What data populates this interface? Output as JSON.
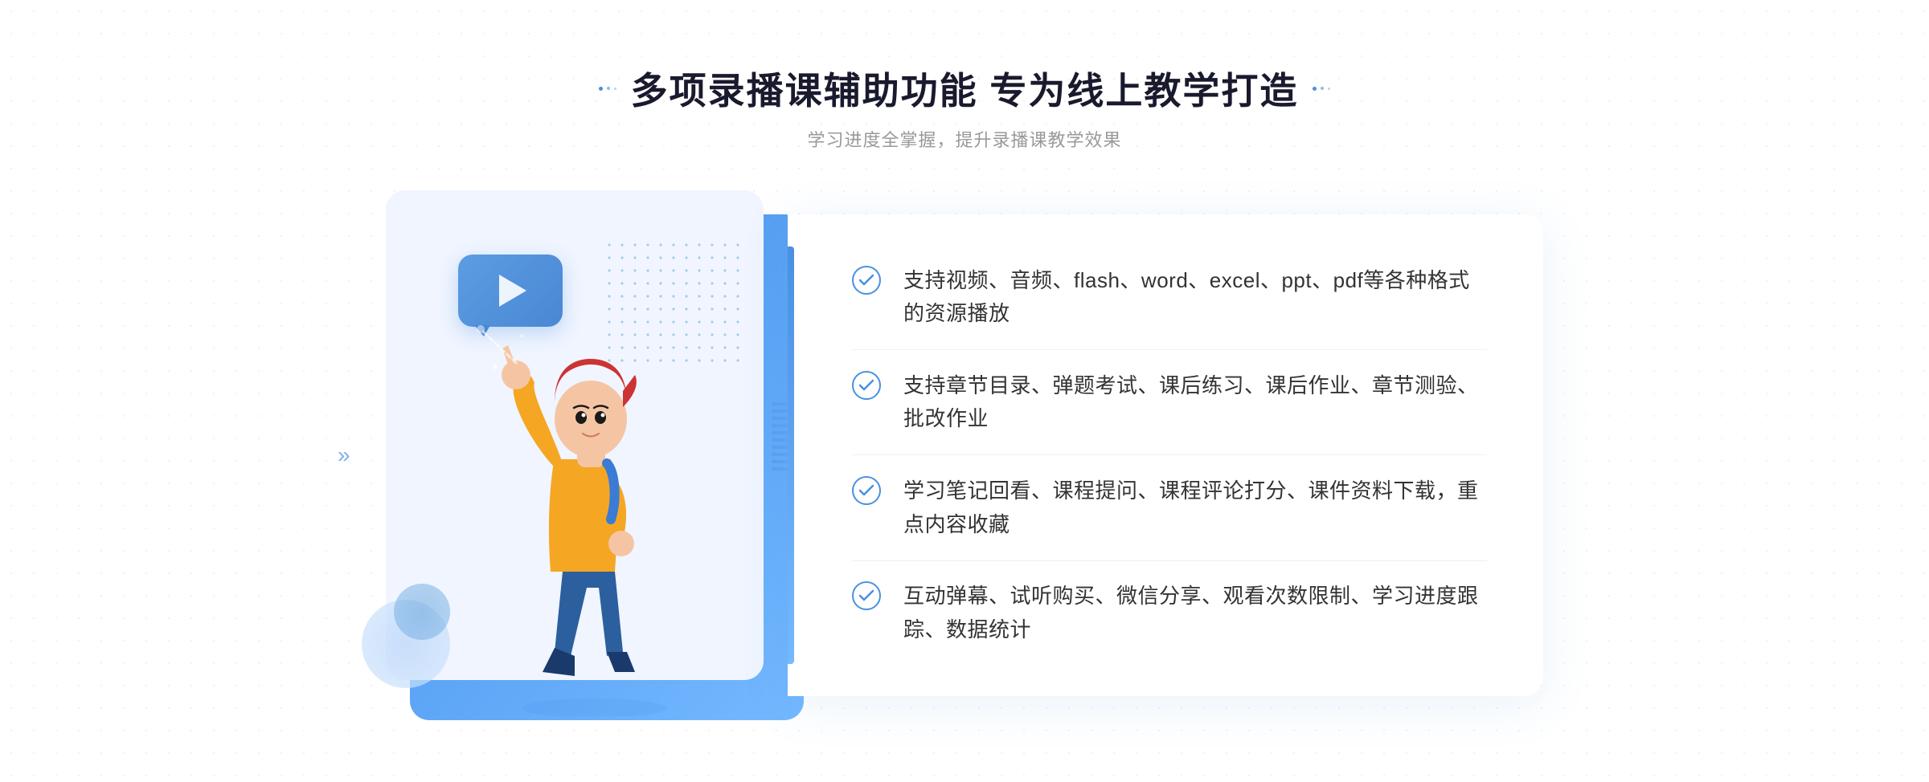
{
  "page": {
    "background": "#ffffff"
  },
  "header": {
    "title": "多项录播课辅助功能 专为线上教学打造",
    "subtitle": "学习进度全掌握，提升录播课教学效果",
    "title_dots_left": "decorative",
    "title_dots_right": "decorative"
  },
  "features": [
    {
      "id": 1,
      "text": "支持视频、音频、flash、word、excel、ppt、pdf等各种格式的资源播放"
    },
    {
      "id": 2,
      "text": "支持章节目录、弹题考试、课后练习、课后作业、章节测验、批改作业"
    },
    {
      "id": 3,
      "text": "学习笔记回看、课程提问、课程评论打分、课件资料下载，重点内容收藏"
    },
    {
      "id": 4,
      "text": "互动弹幕、试听购买、微信分享、观看次数限制、学习进度跟踪、数据统计"
    }
  ],
  "colors": {
    "primary": "#4a90e2",
    "light_blue": "#74b9ff",
    "title_dark": "#1a1a2e",
    "text_gray": "#999999",
    "feature_text": "#333333"
  },
  "icons": {
    "play": "▶",
    "check": "✓",
    "chevron_right": "»"
  }
}
